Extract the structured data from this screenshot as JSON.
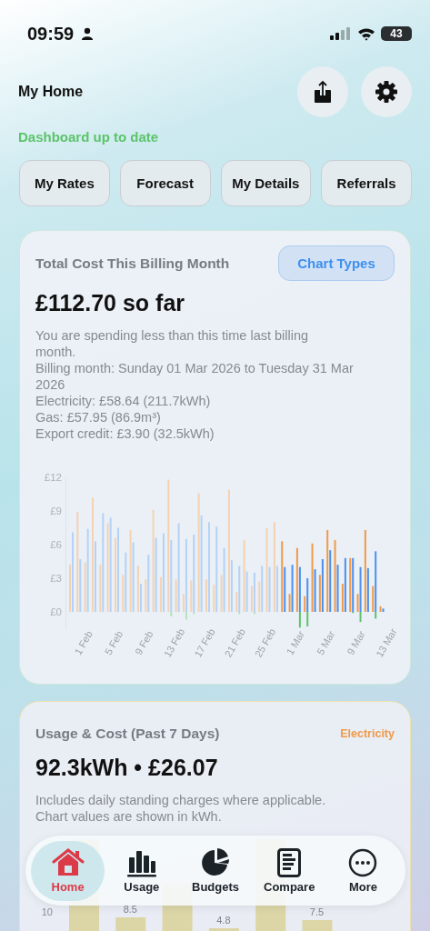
{
  "status_bar": {
    "time": "09:59",
    "battery": "43"
  },
  "header": {
    "title": "My Home",
    "status": "Dashboard up to date"
  },
  "quick_actions": [
    "My Rates",
    "Forecast",
    "My Details",
    "Referrals"
  ],
  "billing_card": {
    "title": "Total Cost This Billing Month",
    "button": "Chart Types",
    "amount": "£112.70 so far",
    "lines": [
      "You are spending less than this time last billing month.",
      "Billing month: Sunday 01 Mar 2026 to Tuesday 31 Mar 2026",
      "Electricity: £58.64 (211.7kWh)",
      "Gas: £57.95 (86.9m³)",
      "Export credit: £3.90 (32.5kWh)"
    ],
    "chart_data": {
      "type": "bar",
      "categories": [
        null,
        null,
        "1 Feb",
        null,
        null,
        null,
        "5 Feb",
        null,
        null,
        null,
        "9 Feb",
        null,
        null,
        null,
        "13 Feb",
        null,
        null,
        null,
        "17 Feb",
        null,
        null,
        null,
        "21 Feb",
        null,
        null,
        null,
        "25 Feb",
        null,
        null,
        null,
        "1 Mar",
        null,
        null,
        null,
        "5 Mar",
        null,
        null,
        null,
        "9 Mar",
        null,
        null,
        null,
        "13 Mar"
      ],
      "series": [
        {
          "color": "#f4d2b2",
          "values": [
            4.2,
            8.9,
            4.4,
            10.2,
            4.2,
            7.9,
            6.6,
            3.3,
            7.3,
            4.1,
            2.9,
            9.1,
            3.1,
            11.8,
            2.9,
            1.6,
            2.8,
            10.6,
            2.9,
            2.4,
            3.3,
            10.9,
            1.8,
            6.4,
            2.3,
            2.7,
            7.5,
            8.0,
            null,
            null,
            null,
            null,
            null,
            null,
            null,
            null,
            null,
            null,
            null,
            null,
            null,
            null,
            null
          ]
        },
        {
          "color": "#b3d2f7",
          "values": [
            7.1,
            4.7,
            7.4,
            6.3,
            8.8,
            8.4,
            7.5,
            5.3,
            6.2,
            2.5,
            5.1,
            6.6,
            7.0,
            6.4,
            7.9,
            6.5,
            6.9,
            8.6,
            8.0,
            7.6,
            5.7,
            4.6,
            4.1,
            3.6,
            3.5,
            4.1,
            4.0,
            4.1,
            null,
            null,
            null,
            null,
            null,
            null,
            null,
            null,
            null,
            null,
            null,
            null,
            null,
            null,
            null
          ]
        },
        {
          "color": "#b4e2b9",
          "values": [
            null,
            null,
            null,
            null,
            null,
            null,
            null,
            null,
            null,
            null,
            null,
            null,
            null,
            -0.4,
            null,
            -0.7,
            -0.2,
            null,
            null,
            null,
            null,
            null,
            -0.2,
            null,
            -0.2,
            null,
            null,
            null,
            null,
            null,
            null,
            null,
            null,
            null,
            null,
            null,
            null,
            null,
            null,
            null,
            null,
            null,
            null
          ]
        },
        {
          "color": "#f0994a",
          "values": [
            null,
            null,
            null,
            null,
            null,
            null,
            null,
            null,
            null,
            null,
            null,
            null,
            null,
            null,
            null,
            null,
            null,
            null,
            null,
            null,
            null,
            null,
            null,
            null,
            null,
            null,
            null,
            null,
            6.3,
            1.6,
            5.7,
            1.4,
            6.1,
            3.3,
            7.3,
            6.4,
            2.5,
            4.8,
            1.6,
            7.3,
            2.3,
            0.5,
            null
          ]
        },
        {
          "color": "#4a8fef",
          "values": [
            null,
            null,
            null,
            null,
            null,
            null,
            null,
            null,
            null,
            null,
            null,
            null,
            null,
            null,
            null,
            null,
            null,
            null,
            null,
            null,
            null,
            null,
            null,
            null,
            null,
            null,
            null,
            null,
            4.0,
            4.2,
            4.0,
            3.0,
            3.8,
            4.7,
            5.5,
            4.2,
            4.8,
            4.8,
            4.0,
            3.9,
            5.4,
            0.3,
            null
          ]
        },
        {
          "color": "#5ec26a",
          "values": [
            null,
            null,
            null,
            null,
            null,
            null,
            null,
            null,
            null,
            null,
            null,
            null,
            null,
            null,
            null,
            null,
            null,
            null,
            null,
            null,
            null,
            null,
            null,
            null,
            null,
            null,
            null,
            null,
            null,
            null,
            -1.4,
            -1.3,
            null,
            null,
            null,
            null,
            null,
            -0.1,
            -0.9,
            null,
            -0.6,
            null,
            null
          ]
        }
      ],
      "ylim": [
        -1.5,
        12
      ],
      "yticks": [
        {
          "value": 0,
          "label": "£0"
        },
        {
          "value": 3,
          "label": "£3"
        },
        {
          "value": 6,
          "label": "£6"
        },
        {
          "value": 9,
          "label": "£9"
        },
        {
          "value": 12,
          "label": "£12"
        }
      ]
    }
  },
  "usage_card": {
    "title": "Usage & Cost (Past 7 Days)",
    "fuel": "Electricity",
    "amount": "92.3kWh • £26.07",
    "lines": [
      "Includes daily standing charges where applicable.",
      "Chart values are shown in kWh."
    ],
    "chart": {
      "axis_labels": [
        "10"
      ],
      "value_labels": [
        "8.5",
        "4.8",
        "7.5"
      ]
    }
  },
  "tab_bar": [
    {
      "label": "Home",
      "selected": true
    },
    {
      "label": "Usage",
      "selected": false
    },
    {
      "label": "Budgets",
      "selected": false
    },
    {
      "label": "Compare",
      "selected": false
    },
    {
      "label": "More",
      "selected": false
    }
  ]
}
